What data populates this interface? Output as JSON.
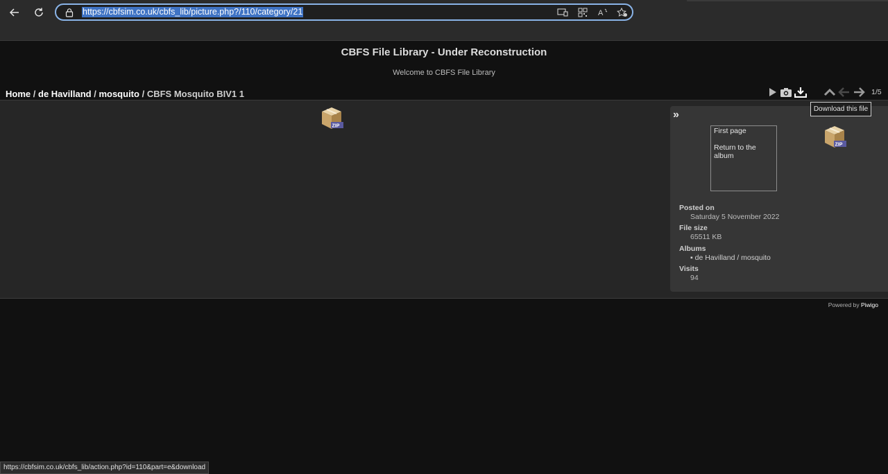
{
  "browser": {
    "url": "https://cbfsim.co.uk/cbfs_lib/picture.php?/110/category/21",
    "back_icon": "←",
    "reload_icon": "↻",
    "status_url": "https://cbfsim.co.uk/cbfs_lib/action.php?id=110&part=e&download"
  },
  "site": {
    "title": "CBFS File Library - Under Reconstruction",
    "subtitle": "Welcome to CBFS File Library"
  },
  "breadcrumb": {
    "home": "Home",
    "sep": "/",
    "cat1": "de Havilland",
    "cat2": "mosquito",
    "current": "CBFS Mosquito BIV1 1"
  },
  "toolbar": {
    "counter": "1/5",
    "tooltip": "Download this file"
  },
  "info": {
    "collapse": "»",
    "first_page": "First page",
    "return_album": "Return to the album",
    "posted_on_label": "Posted on",
    "posted_on_value": "Saturday 5 November 2022",
    "file_size_label": "File size",
    "file_size_value": "65511 KB",
    "albums_label": "Albums",
    "albums_value": "de Havilland / mosquito",
    "visits_label": "Visits",
    "visits_value": "94"
  },
  "footer": {
    "powered_by": "Powered by",
    "piwigo": "Piwigo"
  },
  "zip_label": "ZIP"
}
